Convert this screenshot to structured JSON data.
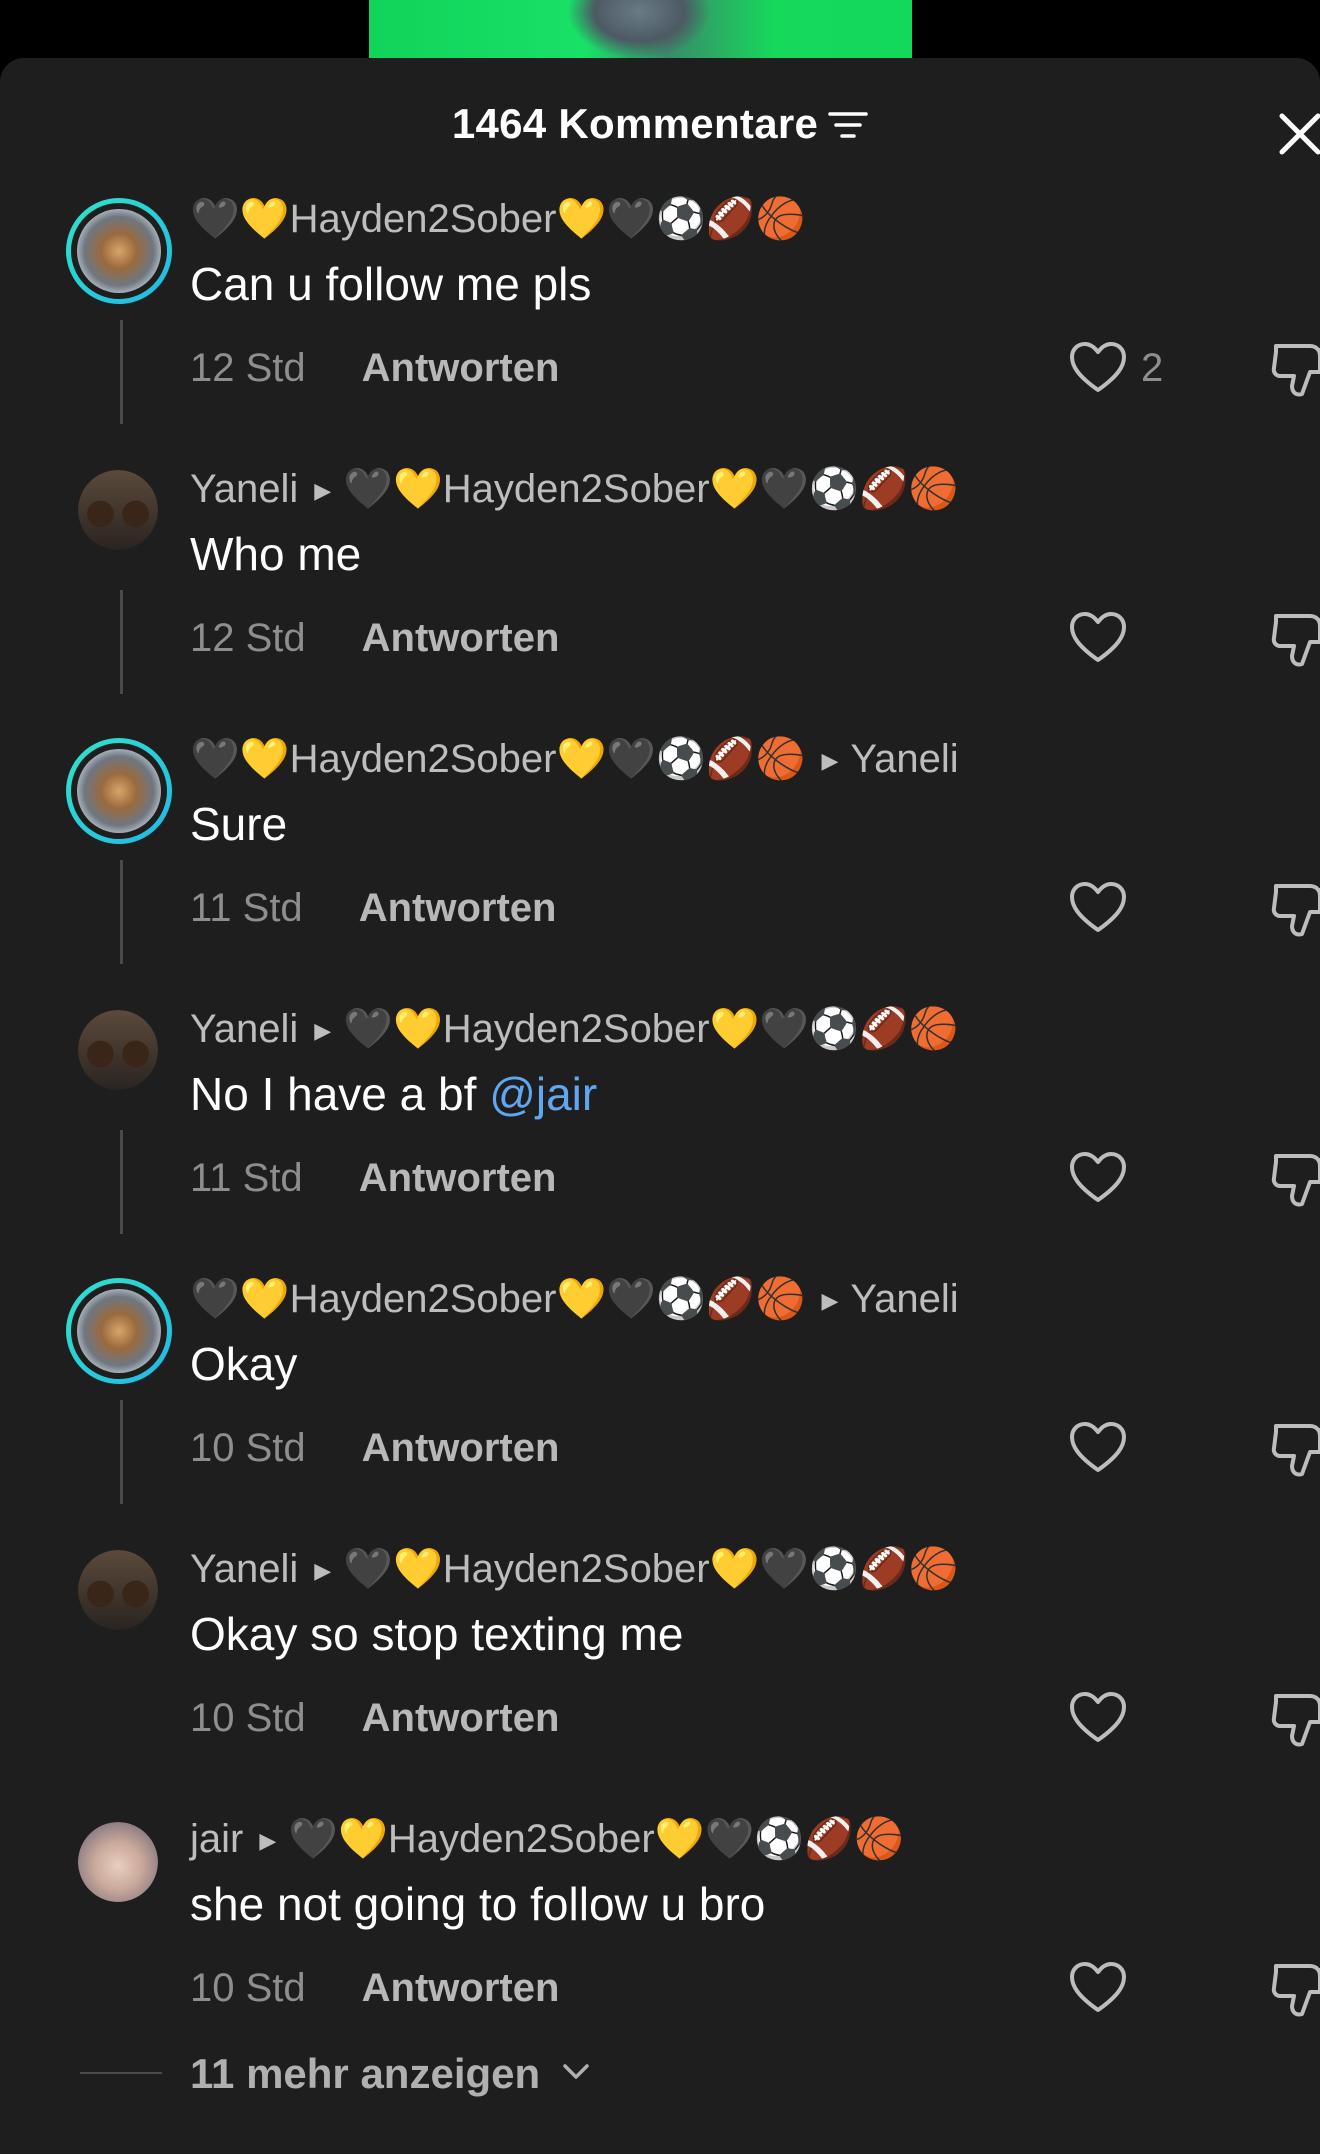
{
  "header": {
    "title": "1464 Kommentare"
  },
  "comments": [
    {
      "author": "🖤💛Hayden2Sober💛🖤⚽🏈🏀",
      "reply_to": "",
      "text": "Can u follow me pls",
      "time": "12 Std",
      "reply_label": "Antworten",
      "likes": "2"
    },
    {
      "author": "Yaneli",
      "reply_to": "🖤💛Hayden2Sober💛🖤⚽🏈🏀",
      "text": "Who me",
      "time": "12 Std",
      "reply_label": "Antworten",
      "likes": ""
    },
    {
      "author": "🖤💛Hayden2Sober💛🖤⚽🏈🏀",
      "reply_to": "Yaneli",
      "text": "Sure",
      "time": "11 Std",
      "reply_label": "Antworten",
      "likes": ""
    },
    {
      "author": "Yaneli",
      "reply_to": "🖤💛Hayden2Sober💛🖤⚽🏈🏀",
      "text": "No I have a bf ",
      "mention": "@jair",
      "time": "11 Std",
      "reply_label": "Antworten",
      "likes": ""
    },
    {
      "author": "🖤💛Hayden2Sober💛🖤⚽🏈🏀",
      "reply_to": "Yaneli",
      "text": "Okay",
      "time": "10 Std",
      "reply_label": "Antworten",
      "likes": ""
    },
    {
      "author": "Yaneli",
      "reply_to": "🖤💛Hayden2Sober💛🖤⚽🏈🏀",
      "text": "Okay so stop texting me",
      "time": "10 Std",
      "reply_label": "Antworten",
      "likes": ""
    },
    {
      "author": "jair",
      "reply_to": "🖤💛Hayden2Sober💛🖤⚽🏈🏀",
      "text": "she not going to follow u bro",
      "time": "10 Std",
      "reply_label": "Antworten",
      "likes": ""
    }
  ],
  "footer": {
    "more_label": "11 mehr anzeigen"
  },
  "colors": {
    "sheet_bg": "#1e1e1e",
    "mention": "#5fa8f0",
    "story_ring": "#2fe4c8"
  }
}
